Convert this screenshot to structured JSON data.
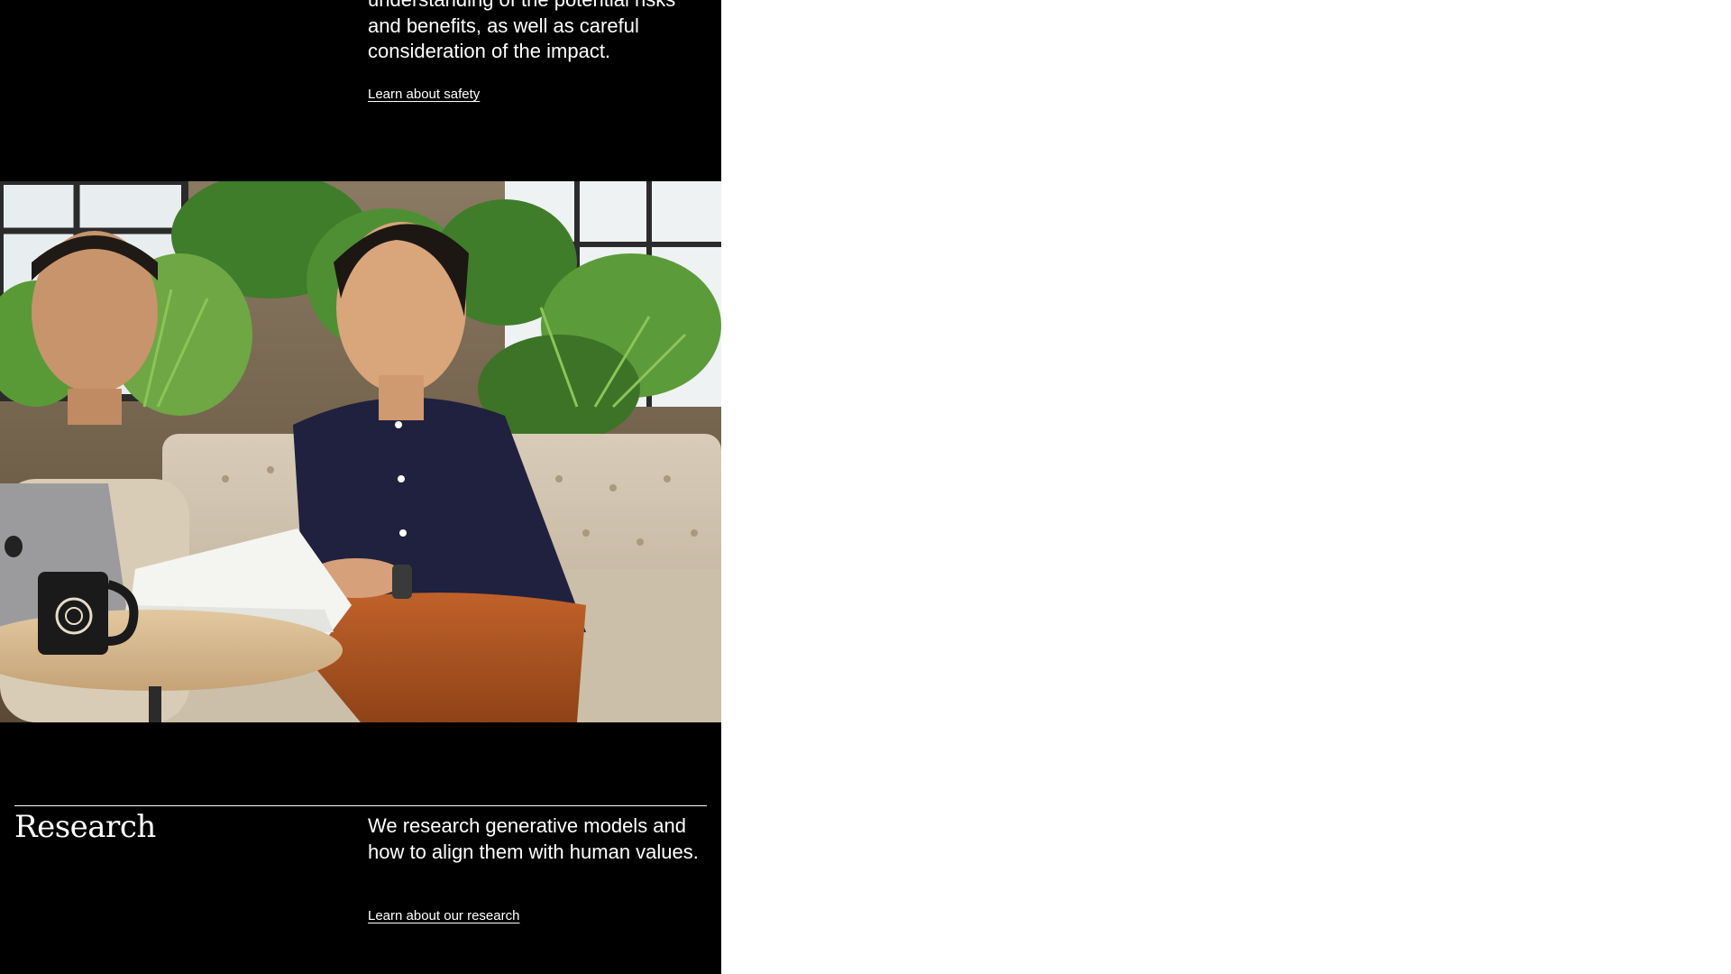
{
  "safety": {
    "body": "understanding of the potential risks and benefits, as well as careful consideration of the impact.",
    "link_label": "Learn about safety"
  },
  "photo": {
    "icon": "team-photo-image"
  },
  "research": {
    "heading": "Research",
    "body": "We research generative models and how to align them with human values.",
    "link_label": "Learn about our research"
  },
  "colors": {
    "background": "#000000",
    "text": "#ffffff",
    "page_outside": "#ffffff"
  }
}
